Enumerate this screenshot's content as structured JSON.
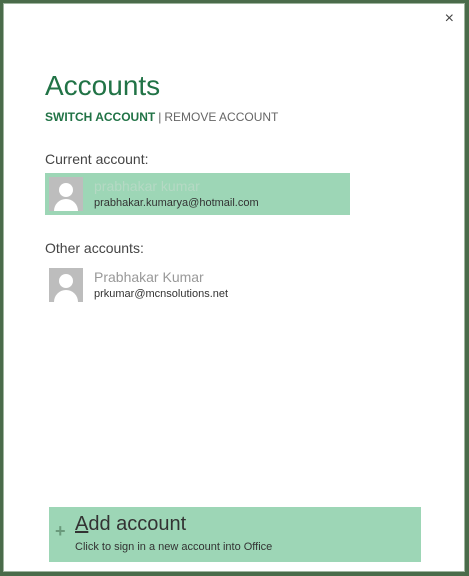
{
  "dialog": {
    "close_glyph": "×",
    "title": "Accounts",
    "switch_account": "SWITCH ACCOUNT",
    "separator": "|",
    "remove_account": "REMOVE ACCOUNT"
  },
  "current": {
    "label": "Current account:",
    "name": "prabhakar kumar",
    "email": "prabhakar.kumarya@hotmail.com",
    "avatar_icon": "user-silhouette-icon"
  },
  "others": {
    "label": "Other accounts:",
    "items": [
      {
        "name": "Prabhakar Kumar",
        "email": "prkumar@mcnsolutions.net",
        "avatar_icon": "user-silhouette-icon"
      }
    ]
  },
  "add_account": {
    "icon": "plus-icon",
    "title_first": "A",
    "title_rest": "dd account",
    "subtitle": "Click to sign in a new account into Office"
  },
  "colors": {
    "accent": "#217346",
    "highlight": "#9dd6b6"
  }
}
